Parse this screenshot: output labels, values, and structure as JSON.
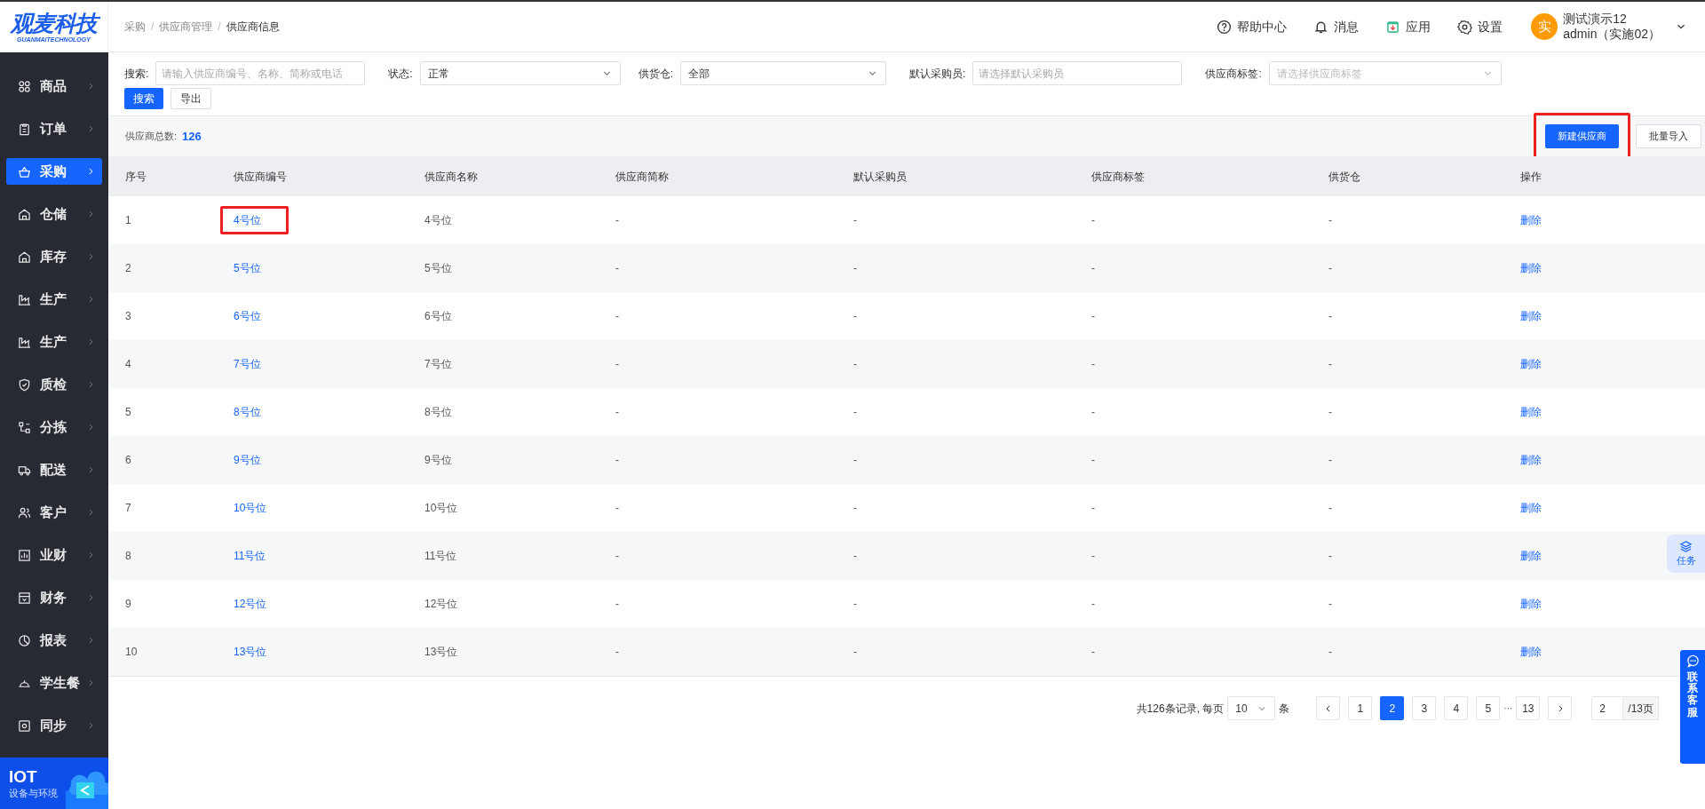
{
  "logo": {
    "title": "观麦科技",
    "subtitle": "GUANMAITECHNOLOGY"
  },
  "sidebar": {
    "items": [
      {
        "label": "商品",
        "selected": false
      },
      {
        "label": "订单",
        "selected": false
      },
      {
        "label": "采购",
        "selected": true
      },
      {
        "label": "仓储",
        "selected": false
      },
      {
        "label": "库存",
        "selected": false
      },
      {
        "label": "生产",
        "selected": false
      },
      {
        "label": "生产",
        "selected": false
      },
      {
        "label": "质检",
        "selected": false
      },
      {
        "label": "分拣",
        "selected": false
      },
      {
        "label": "配送",
        "selected": false
      },
      {
        "label": "客户",
        "selected": false
      },
      {
        "label": "业财",
        "selected": false
      },
      {
        "label": "财务",
        "selected": false
      },
      {
        "label": "报表",
        "selected": false
      },
      {
        "label": "学生餐",
        "selected": false
      },
      {
        "label": "同步",
        "selected": false
      }
    ],
    "banner": {
      "title": "IOT",
      "subtitle": "设备与环境"
    }
  },
  "breadcrumb": {
    "items": [
      "采购",
      "供应商管理",
      "供应商信息"
    ],
    "separator": "/"
  },
  "header_actions": [
    "帮助中心",
    "消息",
    "应用",
    "设置"
  ],
  "user": {
    "avatar": "实",
    "name": "测试演示12",
    "account": "admin（实施02）"
  },
  "filters": [
    {
      "kind": "input",
      "label": "搜索:",
      "placeholder": "请输入供应商编号、名称、简称或电话"
    },
    {
      "kind": "select",
      "label": "状态:",
      "value": "正常"
    },
    {
      "kind": "select",
      "label": "供货仓:",
      "value": "全部"
    },
    {
      "kind": "input",
      "label": "默认采购员:",
      "placeholder": "请选择默认采购员"
    },
    {
      "kind": "select",
      "label": "供应商标签:",
      "placeholder": "请选择供应商标签"
    }
  ],
  "filter_buttons": [
    {
      "label": "搜索",
      "primary": true
    },
    {
      "label": "导出",
      "primary": false
    }
  ],
  "summary": {
    "label": "供应商总数:",
    "count": "126"
  },
  "toolbar_buttons": [
    {
      "label": "新建供应商",
      "primary": true,
      "highlighted": true
    },
    {
      "label": "批量导入",
      "primary": false,
      "highlighted": false
    }
  ],
  "table": {
    "columns": [
      "序号",
      "供应商编号",
      "供应商名称",
      "供应商简称",
      "默认采购员",
      "供应商标签",
      "供货仓",
      "操作"
    ],
    "rows": [
      {
        "cells": [
          "1",
          "4号位",
          "4号位",
          "-",
          "-",
          "-",
          "-"
        ],
        "action": "删除",
        "highlighted": true
      },
      {
        "cells": [
          "2",
          "5号位",
          "5号位",
          "-",
          "-",
          "-",
          "-"
        ],
        "action": "删除",
        "highlighted": false
      },
      {
        "cells": [
          "3",
          "6号位",
          "6号位",
          "-",
          "-",
          "-",
          "-"
        ],
        "action": "删除",
        "highlighted": false
      },
      {
        "cells": [
          "4",
          "7号位",
          "7号位",
          "-",
          "-",
          "-",
          "-"
        ],
        "action": "删除",
        "highlighted": false
      },
      {
        "cells": [
          "5",
          "8号位",
          "8号位",
          "-",
          "-",
          "-",
          "-"
        ],
        "action": "删除",
        "highlighted": false
      },
      {
        "cells": [
          "6",
          "9号位",
          "9号位",
          "-",
          "-",
          "-",
          "-"
        ],
        "action": "删除",
        "highlighted": false
      },
      {
        "cells": [
          "7",
          "10号位",
          "10号位",
          "-",
          "-",
          "-",
          "-"
        ],
        "action": "删除",
        "highlighted": false
      },
      {
        "cells": [
          "8",
          "11号位",
          "11号位",
          "-",
          "-",
          "-",
          "-"
        ],
        "action": "删除",
        "highlighted": false
      },
      {
        "cells": [
          "9",
          "12号位",
          "12号位",
          "-",
          "-",
          "-",
          "-"
        ],
        "action": "删除",
        "highlighted": false
      },
      {
        "cells": [
          "10",
          "13号位",
          "13号位",
          "-",
          "-",
          "-",
          "-"
        ],
        "action": "删除",
        "highlighted": false
      }
    ]
  },
  "pagination": {
    "summary": "共126条记录, 每页",
    "page_size": "10",
    "unit": "条",
    "pages": [
      {
        "kind": "page",
        "label": "1",
        "selected": false
      },
      {
        "kind": "page",
        "label": "2",
        "selected": true
      },
      {
        "kind": "page",
        "label": "3",
        "selected": false
      },
      {
        "kind": "page",
        "label": "4",
        "selected": false
      },
      {
        "kind": "page",
        "label": "5",
        "selected": false
      },
      {
        "kind": "ellipsis",
        "label": "···",
        "selected": false
      },
      {
        "kind": "page",
        "label": "13",
        "selected": false
      }
    ],
    "jump_value": "2",
    "total": "/13页"
  },
  "floating": {
    "task": "任务",
    "contact": "联系客服"
  }
}
